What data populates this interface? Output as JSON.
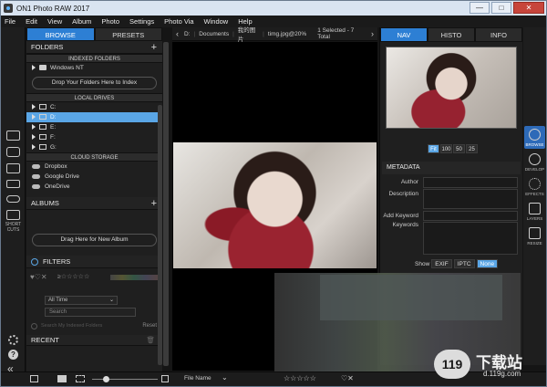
{
  "app": {
    "title": "ON1 Photo RAW 2017",
    "accent": "#2d7fd4",
    "selection": "#5aa6e6"
  },
  "window_controls": {
    "minimize": "—",
    "maximize": "□",
    "close": "✕"
  },
  "menu": [
    "File",
    "Edit",
    "View",
    "Album",
    "Photo",
    "Settings",
    "Photo Via",
    "Window",
    "Help"
  ],
  "left_rail": [
    {
      "icon": "monitor-icon",
      "label": ""
    },
    {
      "icon": "camera-icon",
      "label": ""
    },
    {
      "icon": "folder-icon",
      "label": ""
    },
    {
      "icon": "drive-icon",
      "label": ""
    },
    {
      "icon": "cloud-icon",
      "label": ""
    },
    {
      "icon": "shortcuts-icon",
      "label": "SHORT CUTS"
    }
  ],
  "left_bottom_icons": [
    "gear-icon",
    "help-icon",
    "collapse-icon"
  ],
  "browse_panel": {
    "tabs": [
      "BROWSE",
      "PRESETS"
    ],
    "folders_header": "FOLDERS",
    "indexed_header": "INDEXED FOLDERS",
    "indexed_items": [
      "Windows NT"
    ],
    "drop_folders": "Drop Your Folders Here to Index",
    "local_header": "LOCAL DRIVES",
    "drives": [
      "C:",
      "D:",
      "E:",
      "F:",
      "G:"
    ],
    "selected_drive": "D:",
    "cloud_header": "CLOUD STORAGE",
    "cloud_items": [
      "Dropbox",
      "Google Drive",
      "OneDrive"
    ],
    "albums_header": "ALBUMS",
    "drop_album": "Drag Here for New Album",
    "filters_header": "FILTERS",
    "time_select": "All Time",
    "search_placeholder": "Search",
    "search_subfolders": "Search My Indexed Folders",
    "reset": "Reset",
    "recent_header": "RECENT"
  },
  "path_bar": {
    "crumbs": [
      "D:",
      "Documents",
      "我的图片",
      "timg.jpg@20%"
    ],
    "selection_status": "1 Selected - 7 Total"
  },
  "right_panel": {
    "tabs": [
      "NAV",
      "HISTO",
      "INFO"
    ],
    "zoom_levels": [
      "Fit",
      "100",
      "50",
      "25"
    ],
    "zoom_selected": "Fit",
    "metadata_header": "METADATA",
    "fields": [
      "Author",
      "Description",
      "Add Keyword",
      "Keywords"
    ],
    "show_label": "Show",
    "show_options": [
      "EXIF",
      "IPTC",
      "None"
    ],
    "show_selected": "None"
  },
  "right_rail": [
    {
      "icon": "browse-icon",
      "label": "BROWSE"
    },
    {
      "icon": "develop-icon",
      "label": "DEVELOP"
    },
    {
      "icon": "effects-icon",
      "label": "EFFECTS"
    },
    {
      "icon": "layers-icon",
      "label": "LAYERS"
    },
    {
      "icon": "resize-icon",
      "label": "RESIZE"
    }
  ],
  "bottom_bar": {
    "sort": "File Name",
    "stars": "☆☆☆☆☆",
    "like": "♡✕"
  },
  "watermark": {
    "brand": "下载站",
    "url": "d.119g.com",
    "logo_text": "119"
  }
}
